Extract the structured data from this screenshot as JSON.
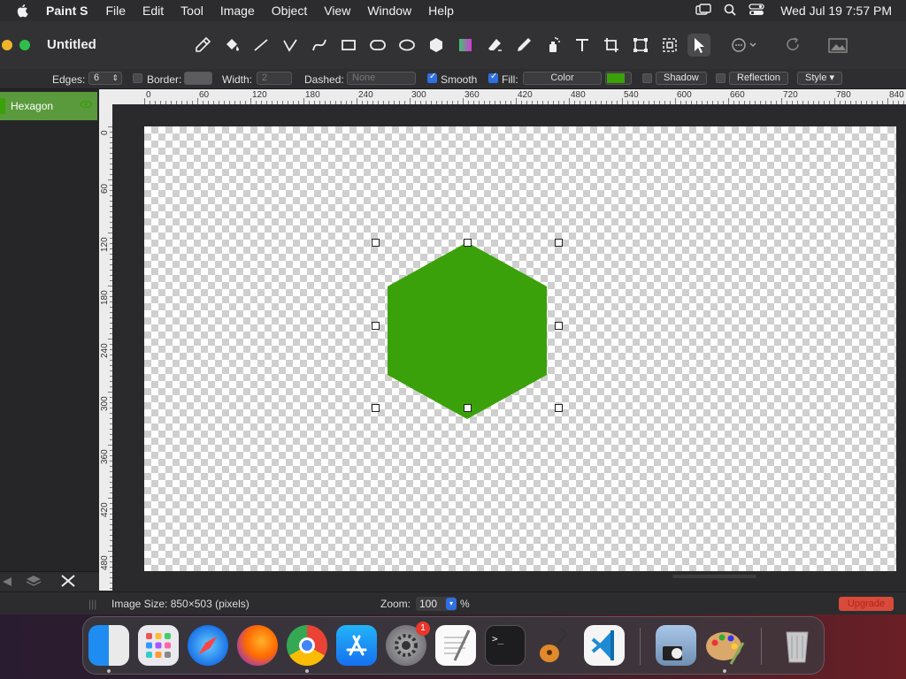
{
  "menubar": {
    "app_name": "Paint S",
    "menus": [
      "File",
      "Edit",
      "Tool",
      "Image",
      "Object",
      "View",
      "Window",
      "Help"
    ],
    "clock": "Wed Jul 19  7:57 PM"
  },
  "window": {
    "title": "Untitled"
  },
  "toolbar": {
    "tools": [
      "eyedropper-icon",
      "paint-bucket-icon",
      "line-icon",
      "polyline-icon",
      "curve-icon",
      "rectangle-icon",
      "rounded-rectangle-icon",
      "ellipse-icon",
      "polygon-icon",
      "gradient-icon",
      "eraser-icon",
      "pencil-icon",
      "spray-icon",
      "text-icon",
      "crop-icon",
      "transform-icon",
      "selection-icon",
      "pointer-icon",
      "more-icon",
      "redo-icon",
      "image-icon"
    ],
    "active_tool": "pointer-icon"
  },
  "options": {
    "edges_label": "Edges:",
    "edges_value": "6",
    "border_label": "Border:",
    "border_checked": false,
    "width_label": "Width:",
    "width_value": "2",
    "dashed_label": "Dashed:",
    "dashed_value": "None",
    "smooth_label": "Smooth",
    "smooth_checked": true,
    "fill_label": "Fill:",
    "fill_checked": true,
    "fill_mode": "Color",
    "fill_color": "#3ba10a",
    "shadow_label": "Shadow",
    "shadow_checked": false,
    "reflection_label": "Reflection",
    "reflection_checked": false,
    "style_label": "Style"
  },
  "layers": {
    "items": [
      {
        "name": "Hexagon",
        "selected": true
      }
    ]
  },
  "ruler": {
    "h_labels": [
      "0",
      "60",
      "120",
      "180",
      "240",
      "300",
      "360",
      "420",
      "480",
      "540",
      "600",
      "660",
      "720",
      "780",
      "840"
    ],
    "v_labels": [
      "0",
      "60",
      "120",
      "180",
      "240",
      "300",
      "360",
      "420",
      "480"
    ]
  },
  "canvas": {
    "shape": "hexagon",
    "shape_color": "#3ba10a"
  },
  "status": {
    "image_size": "Image Size: 850×503 (pixels)",
    "zoom_label": "Zoom:",
    "zoom_value": "100",
    "zoom_unit": "%",
    "upgrade_label": "Upgrade"
  },
  "dock": {
    "apps": [
      "Finder",
      "Launchpad",
      "Safari",
      "Firefox",
      "Chrome",
      "App Store",
      "System Settings",
      "TextEdit",
      "Terminal",
      "GarageBand",
      "Visual Studio Code",
      "Preview",
      "Paint S",
      "Trash"
    ],
    "system_settings_badge": "1"
  }
}
